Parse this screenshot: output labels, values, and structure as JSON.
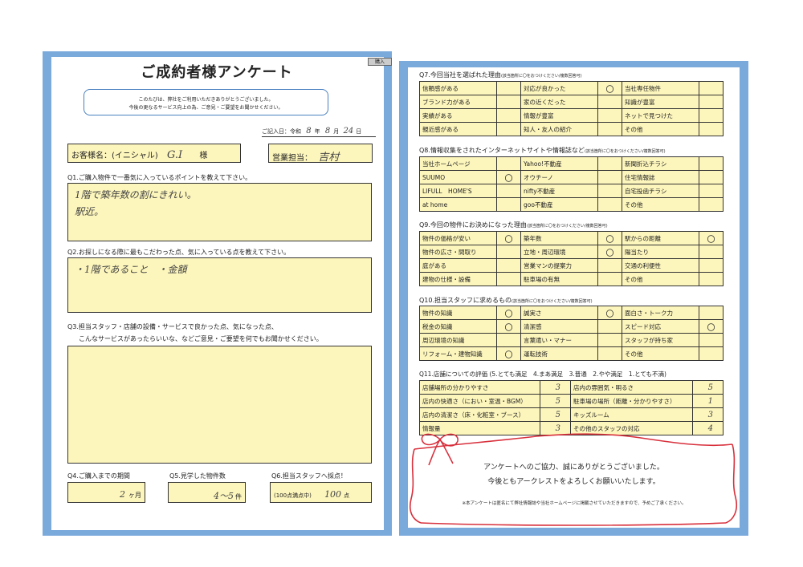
{
  "left": {
    "title": "ご成約者様アンケート",
    "tag": "購入",
    "greeting_line1": "このたびは、弊社をご利用いただきありがとうございました。",
    "greeting_line2": "今後の更なるサービス向上の為、ご意見・ご要望をお聞かせください。",
    "date_prefix": "ご記入日：令和",
    "date_year": "8",
    "date_year_unit": "年",
    "date_month": "8",
    "date_month_unit": "月",
    "date_day": "24",
    "date_day_unit": "日",
    "customer_label": "お客様名：(イニシャル)",
    "customer_value": "G.I",
    "customer_suffix": "様",
    "staff_label": "営業担当：",
    "staff_value": "吉村",
    "q1": {
      "question": "Q1.ご購入物件で一番気に入っているポイントを教えて下さい。",
      "answer_line1": "1階で築年数の割にきれい。",
      "answer_line2": "駅近。"
    },
    "q2": {
      "question": "Q2.お探しになる際に最もこだわった点、気に入っている点を教えて下さい。",
      "answer": "・1階であること　・金額"
    },
    "q3": {
      "question_line1": "Q3.担当スタッフ・店舗の設備・サービスで良かった点、気になった点、",
      "question_line2": "こんなサービスがあったらいいな、などご意見・ご要望を何でもお聞かせください。"
    },
    "q4": {
      "label": "Q4.ご購入までの期間",
      "value": "2",
      "unit": "ヶ月"
    },
    "q5": {
      "label": "Q5.見学した物件数",
      "value": "4〜5",
      "unit": "件"
    },
    "q6": {
      "label": "Q6.担当スタッフへ採点！",
      "prefix": "(100点満点中)",
      "value": "100",
      "unit": "点"
    }
  },
  "right": {
    "q7": {
      "title": "Q7.今回当社を選ばれた理由",
      "note": "(該当箇所に〇をおつけください/複数回答可)",
      "rows": [
        [
          {
            "l": "信頼感がある",
            "m": ""
          },
          {
            "l": "対応が良かった",
            "m": "〇"
          },
          {
            "l": "当社専任物件",
            "m": ""
          }
        ],
        [
          {
            "l": "ブランド力がある",
            "m": ""
          },
          {
            "l": "家の近くだった",
            "m": ""
          },
          {
            "l": "知識が豊富",
            "m": ""
          }
        ],
        [
          {
            "l": "実績がある",
            "m": ""
          },
          {
            "l": "情報が豊富",
            "m": ""
          },
          {
            "l": "ネットで見つけた",
            "m": ""
          }
        ],
        [
          {
            "l": "親近感がある",
            "m": ""
          },
          {
            "l": "知人・友人の紹介",
            "m": ""
          },
          {
            "l": "その他",
            "m": ""
          }
        ]
      ]
    },
    "q8": {
      "title": "Q8.情報収集をされたインターネットサイトや情報誌など",
      "note": "(該当箇所に〇をおつけください/複数回答可)",
      "rows": [
        [
          {
            "l": "当社ホームページ",
            "m": ""
          },
          {
            "l": "Yahoo!不動産",
            "m": ""
          },
          {
            "l": "新聞折込チラシ",
            "m": ""
          }
        ],
        [
          {
            "l": "SUUMO",
            "m": "〇"
          },
          {
            "l": "オウチーノ",
            "m": ""
          },
          {
            "l": "住宅情報誌",
            "m": ""
          }
        ],
        [
          {
            "l": "LIFULL　HOME'S",
            "m": ""
          },
          {
            "l": "nifty不動産",
            "m": ""
          },
          {
            "l": "自宅投函チラシ",
            "m": ""
          }
        ],
        [
          {
            "l": "at home",
            "m": ""
          },
          {
            "l": "goo不動産",
            "m": ""
          },
          {
            "l": "その他",
            "m": ""
          }
        ]
      ]
    },
    "q9": {
      "title": "Q9.今回の物件にお決めになった理由",
      "note": "(該当箇所に〇をおつけください/複数回答可)",
      "rows": [
        [
          {
            "l": "物件の価格が安い",
            "m": "〇"
          },
          {
            "l": "築年数",
            "m": "〇"
          },
          {
            "l": "駅からの距離",
            "m": "〇"
          }
        ],
        [
          {
            "l": "物件の広さ・間取り",
            "m": ""
          },
          {
            "l": "立地・周辺環境",
            "m": "〇"
          },
          {
            "l": "陽当たり",
            "m": ""
          }
        ],
        [
          {
            "l": "庭がある",
            "m": ""
          },
          {
            "l": "営業マンの提案力",
            "m": ""
          },
          {
            "l": "交通の利便性",
            "m": ""
          }
        ],
        [
          {
            "l": "建物の仕様・設備",
            "m": ""
          },
          {
            "l": "駐車場の有無",
            "m": ""
          },
          {
            "l": "その他",
            "m": ""
          }
        ]
      ]
    },
    "q10": {
      "title": "Q10.担当スタッフに求めるもの",
      "note": "(該当箇所に〇をおつけください/複数回答可)",
      "rows": [
        [
          {
            "l": "物件の知識",
            "m": "〇"
          },
          {
            "l": "誠実さ",
            "m": "〇"
          },
          {
            "l": "面白さ・トーク力",
            "m": ""
          }
        ],
        [
          {
            "l": "税金の知識",
            "m": "〇"
          },
          {
            "l": "清潔感",
            "m": ""
          },
          {
            "l": "スピード対応",
            "m": "〇"
          }
        ],
        [
          {
            "l": "周辺環境の知識",
            "m": ""
          },
          {
            "l": "言葉遣い・マナー",
            "m": ""
          },
          {
            "l": "スタッフが持ち家",
            "m": ""
          }
        ],
        [
          {
            "l": "リフォーム・建物知識",
            "m": "〇"
          },
          {
            "l": "運転技術",
            "m": ""
          },
          {
            "l": "その他",
            "m": ""
          }
        ]
      ]
    },
    "q11": {
      "title": "Q11.店舗についての評価 (5.とても満足　4.まあ満足　3.普通　2.やや満足　1.とても不満)",
      "rows": [
        [
          {
            "l": "店舗場所の分かりやすさ",
            "s": "3"
          },
          {
            "l": "店内の雰囲気・明るさ",
            "s": "5"
          }
        ],
        [
          {
            "l": "店内の快適さ（におい・室温・BGM）",
            "s": "5"
          },
          {
            "l": "駐車場の場所（距離・分かりやすさ）",
            "s": "1"
          }
        ],
        [
          {
            "l": "店内の清潔さ（床・化粧室・ブース）",
            "s": "5"
          },
          {
            "l": "キッズルーム",
            "s": "3"
          }
        ],
        [
          {
            "l": "情報量",
            "s": "3"
          },
          {
            "l": "その他のスタッフの対応",
            "s": "4"
          }
        ]
      ]
    },
    "thanks_line1": "アンケートへのご協力、誠にありがとうございました。",
    "thanks_line2": "今後ともアークレストをよろしくお願いいたします。",
    "footnote": "※本アンケートは匿名にて弊社情報誌や当社ホームページに掲載させていただきますので、予めご了承ください。"
  },
  "colors": {
    "frame": "#7aa9dc",
    "field": "#fdf6bc",
    "ribbon": "#d8303c"
  }
}
